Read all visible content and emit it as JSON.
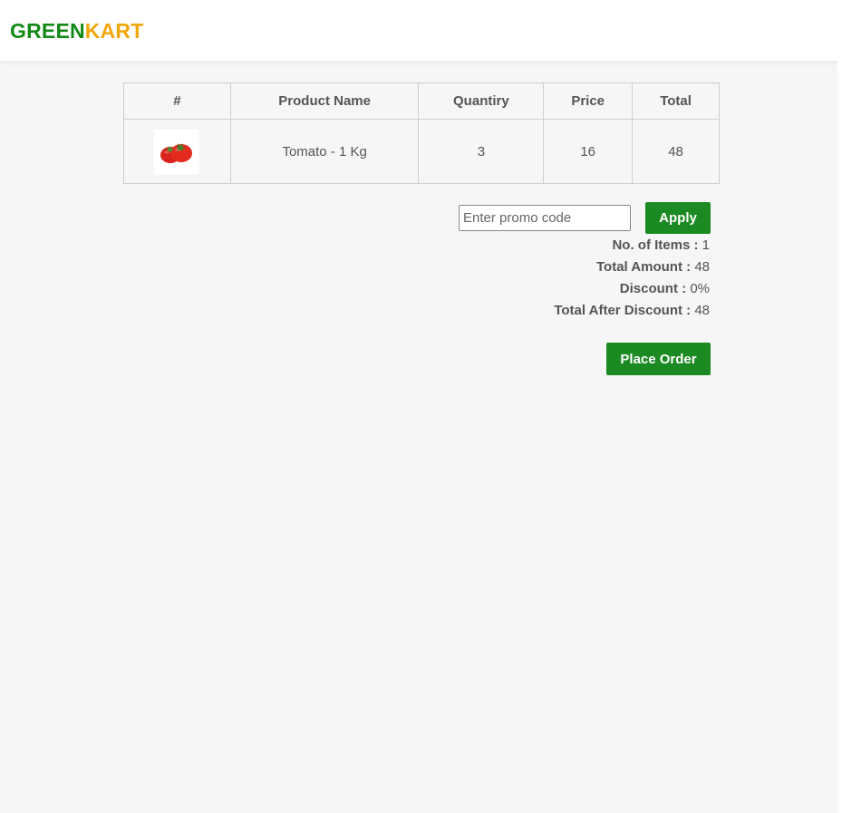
{
  "brand": {
    "part1": "GREEN",
    "part2": "KART"
  },
  "table": {
    "headers": [
      "#",
      "Product Name",
      "Quantiry",
      "Price",
      "Total"
    ],
    "rows": [
      {
        "image": "tomato-image",
        "name": "Tomato - 1 Kg",
        "quantity": "3",
        "price": "16",
        "total": "48"
      }
    ]
  },
  "promo": {
    "placeholder": "Enter promo code",
    "value": "",
    "apply_label": "Apply"
  },
  "summary": {
    "items_label": "No. of Items :",
    "items_value": "1",
    "amount_label": "Total Amount :",
    "amount_value": "48",
    "discount_label": "Discount :",
    "discount_value": "0%",
    "after_label": "Total After Discount :",
    "after_value": "48"
  },
  "place_order_label": "Place Order",
  "colors": {
    "brand_green": "#138a17",
    "brand_orange": "#f0a70c",
    "button_green": "#1c8a23"
  }
}
